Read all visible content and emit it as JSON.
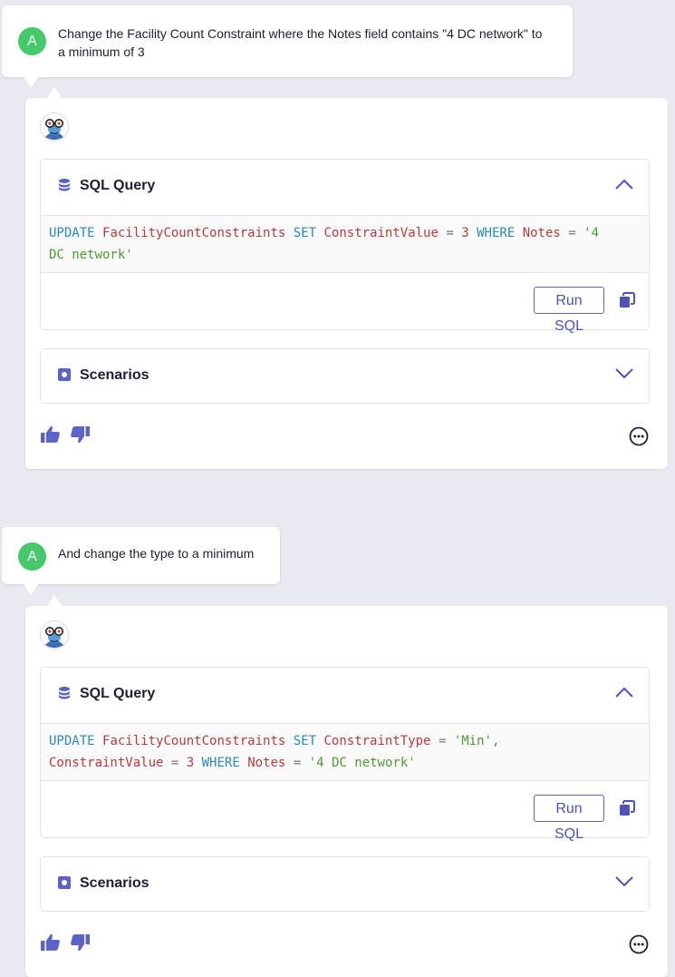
{
  "accent_color": "#5b62c8",
  "user_avatar_color": "#46c96c",
  "conversation": [
    {
      "user": {
        "avatar_letter": "A",
        "message_lines": [
          "Change the Facility Count Constraint where the Notes field contains \"4 DC network\" to",
          "a minimum of 3"
        ]
      },
      "bot": {
        "avatar_icon": "bot-avatar-icon",
        "sql_panel": {
          "title": "SQL Query",
          "icon": "database-icon",
          "state": "expanded",
          "code_lines": [
            [
              {
                "t": "UPDATE",
                "c": "kw"
              },
              {
                "t": " ",
                "c": ""
              },
              {
                "t": "FacilityCountConstraints",
                "c": "id"
              },
              {
                "t": " ",
                "c": ""
              },
              {
                "t": "SET",
                "c": "kw"
              },
              {
                "t": " ",
                "c": ""
              },
              {
                "t": "ConstraintValue",
                "c": "id"
              },
              {
                "t": " ",
                "c": ""
              },
              {
                "t": "=",
                "c": "op"
              },
              {
                "t": " ",
                "c": ""
              },
              {
                "t": "3",
                "c": "num"
              },
              {
                "t": " ",
                "c": ""
              },
              {
                "t": "WHERE",
                "c": "kw"
              },
              {
                "t": " ",
                "c": ""
              },
              {
                "t": "Notes",
                "c": "id"
              },
              {
                "t": " ",
                "c": ""
              },
              {
                "t": "=",
                "c": "op"
              },
              {
                "t": " ",
                "c": ""
              },
              {
                "t": "'4",
                "c": "str"
              }
            ],
            [
              {
                "t": "DC network'",
                "c": "str"
              }
            ]
          ],
          "run_label": "Run SQL",
          "copy_icon": "copy-icon"
        },
        "scenarios_panel": {
          "title": "Scenarios",
          "icon": "scenario-icon",
          "state": "collapsed"
        },
        "feedback": {
          "like_icon": "thumbs-up-icon",
          "dislike_icon": "thumbs-down-icon",
          "more_icon": "more-options-icon"
        }
      }
    },
    {
      "user": {
        "avatar_letter": "A",
        "message_lines": [
          "And change the type to a minimum"
        ]
      },
      "bot": {
        "avatar_icon": "bot-avatar-icon",
        "sql_panel": {
          "title": "SQL Query",
          "icon": "database-icon",
          "state": "expanded",
          "code_lines": [
            [
              {
                "t": "UPDATE",
                "c": "kw"
              },
              {
                "t": " ",
                "c": ""
              },
              {
                "t": "FacilityCountConstraints",
                "c": "id"
              },
              {
                "t": " ",
                "c": ""
              },
              {
                "t": "SET",
                "c": "kw"
              },
              {
                "t": " ",
                "c": ""
              },
              {
                "t": "ConstraintType",
                "c": "id"
              },
              {
                "t": " ",
                "c": ""
              },
              {
                "t": "=",
                "c": "op"
              },
              {
                "t": " ",
                "c": ""
              },
              {
                "t": "'Min'",
                "c": "str"
              },
              {
                "t": ",",
                "c": "op"
              }
            ],
            [
              {
                "t": "ConstraintValue",
                "c": "id"
              },
              {
                "t": " ",
                "c": ""
              },
              {
                "t": "=",
                "c": "op"
              },
              {
                "t": " ",
                "c": ""
              },
              {
                "t": "3",
                "c": "num"
              },
              {
                "t": " ",
                "c": ""
              },
              {
                "t": "WHERE",
                "c": "kw"
              },
              {
                "t": " ",
                "c": ""
              },
              {
                "t": "Notes",
                "c": "id"
              },
              {
                "t": " ",
                "c": ""
              },
              {
                "t": "=",
                "c": "op"
              },
              {
                "t": " ",
                "c": ""
              },
              {
                "t": "'4 DC network'",
                "c": "str"
              }
            ]
          ],
          "run_label": "Run SQL",
          "copy_icon": "copy-icon"
        },
        "scenarios_panel": {
          "title": "Scenarios",
          "icon": "scenario-icon",
          "state": "collapsed"
        },
        "feedback": {
          "like_icon": "thumbs-up-icon",
          "dislike_icon": "thumbs-down-icon",
          "more_icon": "more-options-icon"
        }
      }
    }
  ]
}
